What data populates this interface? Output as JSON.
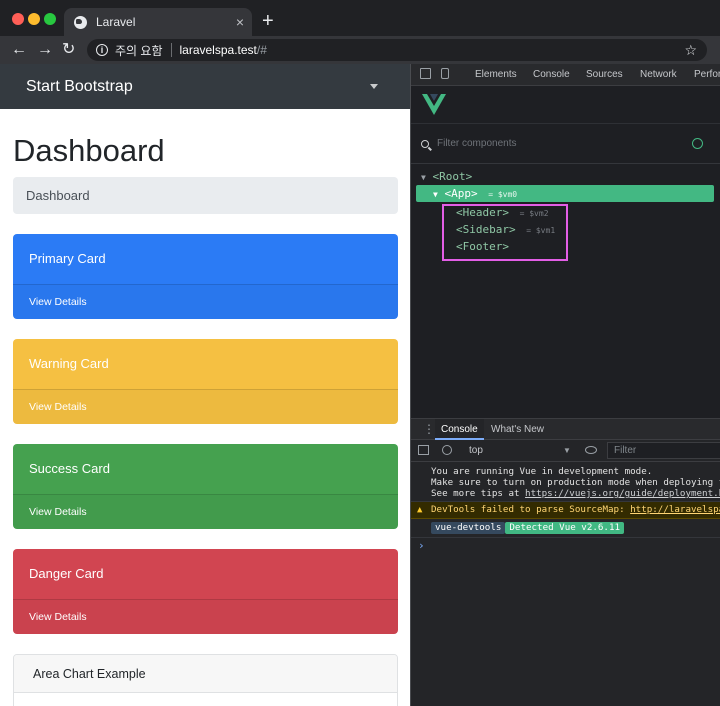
{
  "browser": {
    "tab_title": "Laravel",
    "tab_close": "×",
    "new_tab": "+",
    "security_label": "주의 요함",
    "url_host": "laravelspa.test",
    "url_path": "/#",
    "nav_back": "←",
    "nav_forward": "→",
    "reload": "↻",
    "bookmark": "☆"
  },
  "page": {
    "brand": "Start Bootstrap",
    "heading": "Dashboard",
    "breadcrumb": "Dashboard",
    "cards": [
      {
        "title": "Primary Card",
        "footer": "View Details",
        "color": "#2b7bf5"
      },
      {
        "title": "Warning Card",
        "footer": "View Details",
        "color": "#f5c042"
      },
      {
        "title": "Success Card",
        "footer": "View Details",
        "color": "#45a14f"
      },
      {
        "title": "Danger Card",
        "footer": "View Details",
        "color": "#d14551"
      }
    ],
    "chart_card_title": "Area Chart Example"
  },
  "devtools": {
    "tabs": [
      "Elements",
      "Console",
      "Sources",
      "Network",
      "Perfor"
    ],
    "vue": {
      "filter_placeholder": "Filter components",
      "tree": [
        {
          "label": "<Root>",
          "vm": ""
        },
        {
          "label": "<App>",
          "vm": "= $vm0"
        },
        {
          "label": "<Header>",
          "vm": "= $vm2"
        },
        {
          "label": "<Sidebar>",
          "vm": "= $vm1"
        },
        {
          "label": "<Footer>",
          "vm": ""
        }
      ],
      "accent_color": "#43b883"
    },
    "console": {
      "tabs": [
        "Console",
        "What's New"
      ],
      "context": "top",
      "filter_placeholder": "Filter",
      "log_lines": [
        "You are running Vue in development mode.",
        "Make sure to turn on production mode when deploying for",
        "See more tips at "
      ],
      "log_link": "https://vuejs.org/guide/deployment.html",
      "warning_text": "DevTools failed to parse SourceMap: ",
      "warning_link": "http://laravelspa.te",
      "badge_left": "vue-devtools",
      "badge_right": "Detected Vue v2.6.11",
      "prompt": "›"
    }
  }
}
